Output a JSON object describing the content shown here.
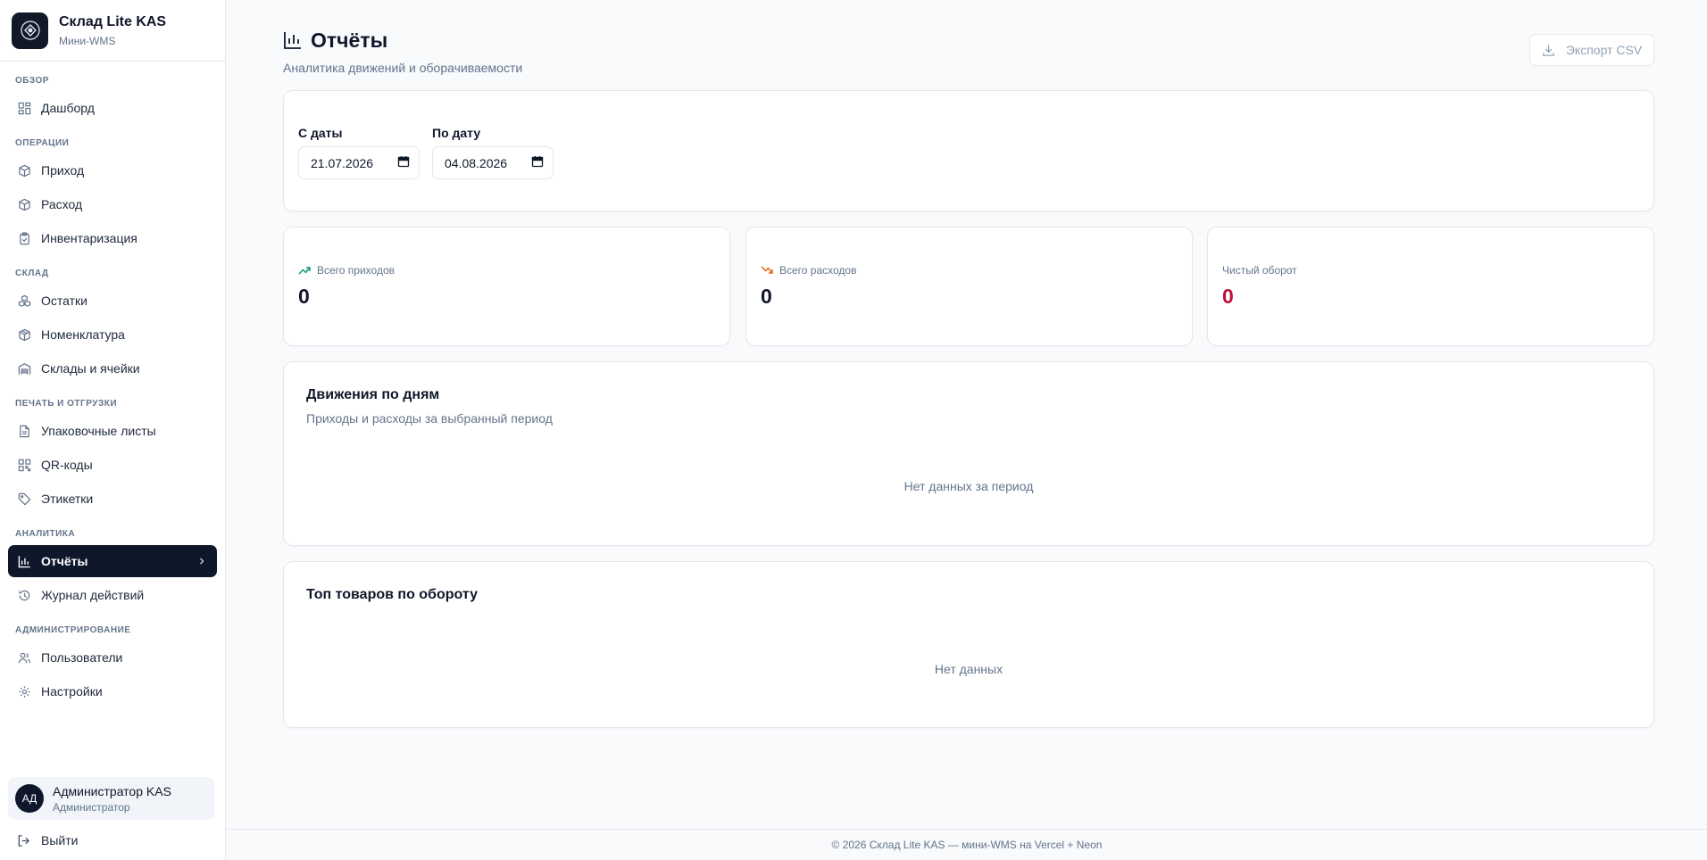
{
  "brand": {
    "title": "Склад Lite KAS",
    "subtitle": "Мини-WMS"
  },
  "sidebar": {
    "sections": [
      {
        "label": "ОБЗОР",
        "items": [
          {
            "label": "Дашборд",
            "icon": "dashboard-icon"
          }
        ]
      },
      {
        "label": "ОПЕРАЦИИ",
        "items": [
          {
            "label": "Приход",
            "icon": "box-in-icon"
          },
          {
            "label": "Расход",
            "icon": "box-out-icon"
          },
          {
            "label": "Инвентаризация",
            "icon": "clipboard-icon"
          }
        ]
      },
      {
        "label": "СКЛАД",
        "items": [
          {
            "label": "Остатки",
            "icon": "boxes-icon"
          },
          {
            "label": "Номенклатура",
            "icon": "package-icon"
          },
          {
            "label": "Склады и ячейки",
            "icon": "warehouse-icon"
          }
        ]
      },
      {
        "label": "ПЕЧАТЬ И ОТГРУЗКИ",
        "items": [
          {
            "label": "Упаковочные листы",
            "icon": "document-icon"
          },
          {
            "label": "QR-коды",
            "icon": "qr-code-icon"
          },
          {
            "label": "Этикетки",
            "icon": "tag-icon"
          }
        ]
      },
      {
        "label": "АНАЛИТИКА",
        "items": [
          {
            "label": "Отчёты",
            "icon": "bar-chart-icon",
            "active": true
          },
          {
            "label": "Журнал действий",
            "icon": "history-icon"
          }
        ]
      },
      {
        "label": "АДМИНИСТРИРОВАНИЕ",
        "items": [
          {
            "label": "Пользователи",
            "icon": "users-icon"
          },
          {
            "label": "Настройки",
            "icon": "gear-icon"
          }
        ]
      }
    ]
  },
  "user": {
    "initials": "АД",
    "name": "Администратор KAS",
    "role": "Администратор"
  },
  "logout_label": "Выйти",
  "page": {
    "title": "Отчёты",
    "subtitle": "Аналитика движений и оборачиваемости",
    "export_label": "Экспорт CSV"
  },
  "filters": {
    "from_label": "С даты",
    "from_value": "21.07.2026",
    "to_label": "По дату",
    "to_value": "04.08.2026"
  },
  "stats": {
    "income": {
      "label": "Всего приходов",
      "value": "0",
      "color": "#059669"
    },
    "expense": {
      "label": "Всего расходов",
      "value": "0",
      "color": "#ea580c"
    },
    "net": {
      "label": "Чистый оборот",
      "value": "0",
      "color": "#be123c"
    }
  },
  "movements": {
    "title": "Движения по дням",
    "subtitle": "Приходы и расходы за выбранный период",
    "empty": "Нет данных за период"
  },
  "top_products": {
    "title": "Топ товаров по обороту",
    "empty": "Нет данных"
  },
  "footer": {
    "text": "© 2026 Склад Lite KAS — мини-WMS на Vercel + Neon"
  }
}
